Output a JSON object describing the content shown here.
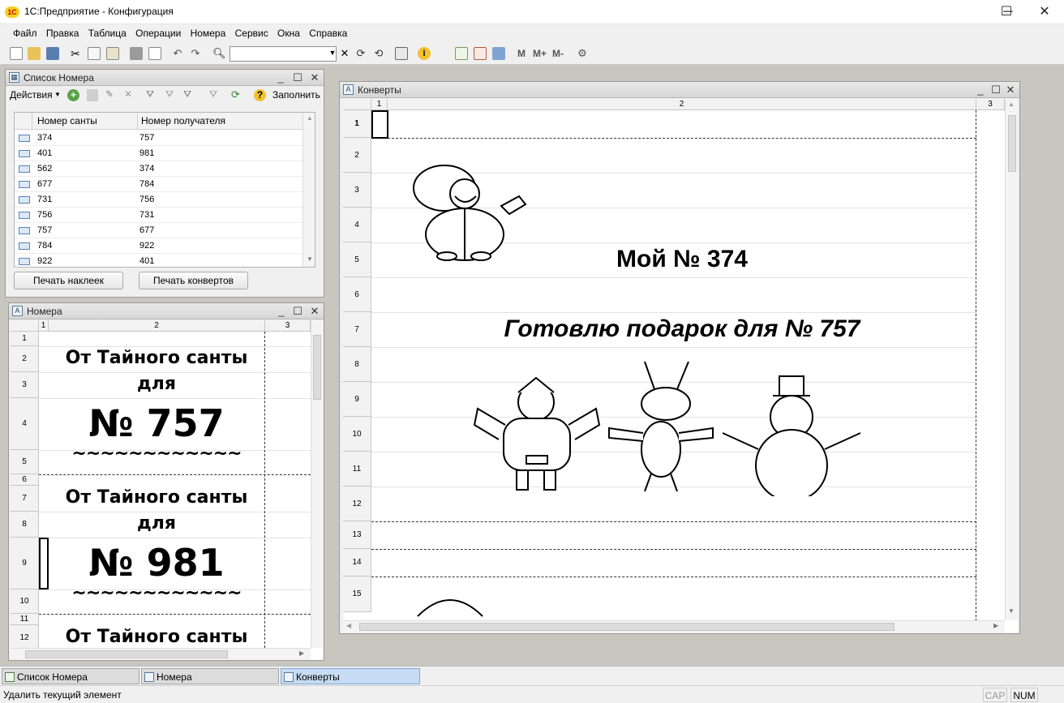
{
  "window": {
    "title": "1С:Предприятие - Конфигурация",
    "logo": "1С",
    "minimize": "─",
    "maximize": "☐",
    "close": "✕"
  },
  "menu": [
    "Файл",
    "Правка",
    "Таблица",
    "Операции",
    "Номера",
    "Сервис",
    "Окна",
    "Справка"
  ],
  "toolbar": {
    "search_value": "",
    "mem_buttons": [
      "M",
      "M+",
      "M-"
    ]
  },
  "list_window": {
    "title": "Список Номера",
    "actions_label": "Действия",
    "fill_label": "Заполнить",
    "columns": [
      "Номер санты",
      "Номер получателя"
    ],
    "rows": [
      [
        "374",
        "757"
      ],
      [
        "401",
        "981"
      ],
      [
        "562",
        "374"
      ],
      [
        "677",
        "784"
      ],
      [
        "731",
        "756"
      ],
      [
        "756",
        "731"
      ],
      [
        "757",
        "677"
      ],
      [
        "784",
        "922"
      ],
      [
        "922",
        "401"
      ]
    ],
    "print_labels_button": "Печать наклеек",
    "print_envelopes_button": "Печать конвертов"
  },
  "labels_window": {
    "title": "Номера",
    "col_headers": [
      "1",
      "2",
      "3"
    ],
    "row_headers": [
      "1",
      "2",
      "3",
      "4",
      "5",
      "6",
      "7",
      "8",
      "9",
      "10",
      "11",
      "12"
    ],
    "from_line1": "От Тайного санты",
    "from_line2": "для",
    "number1": "№ 757",
    "number2": "№ 981",
    "tilde": "~~~~~~~~~~~~"
  },
  "envelope_window": {
    "title": "Конверты",
    "col_headers": [
      "1",
      "2",
      "3"
    ],
    "row_headers": [
      "1",
      "2",
      "3",
      "4",
      "5",
      "6",
      "7",
      "8",
      "9",
      "10",
      "11",
      "12",
      "13",
      "14",
      "15"
    ],
    "my_number": "Мой №  374",
    "preparing_gift": "Готовлю подарок для № 757"
  },
  "taskbar": [
    "Список Номера",
    "Номера",
    "Конверты"
  ],
  "status": {
    "message": "Удалить текущий элемент",
    "cap": "CAP",
    "num": "NUM"
  }
}
